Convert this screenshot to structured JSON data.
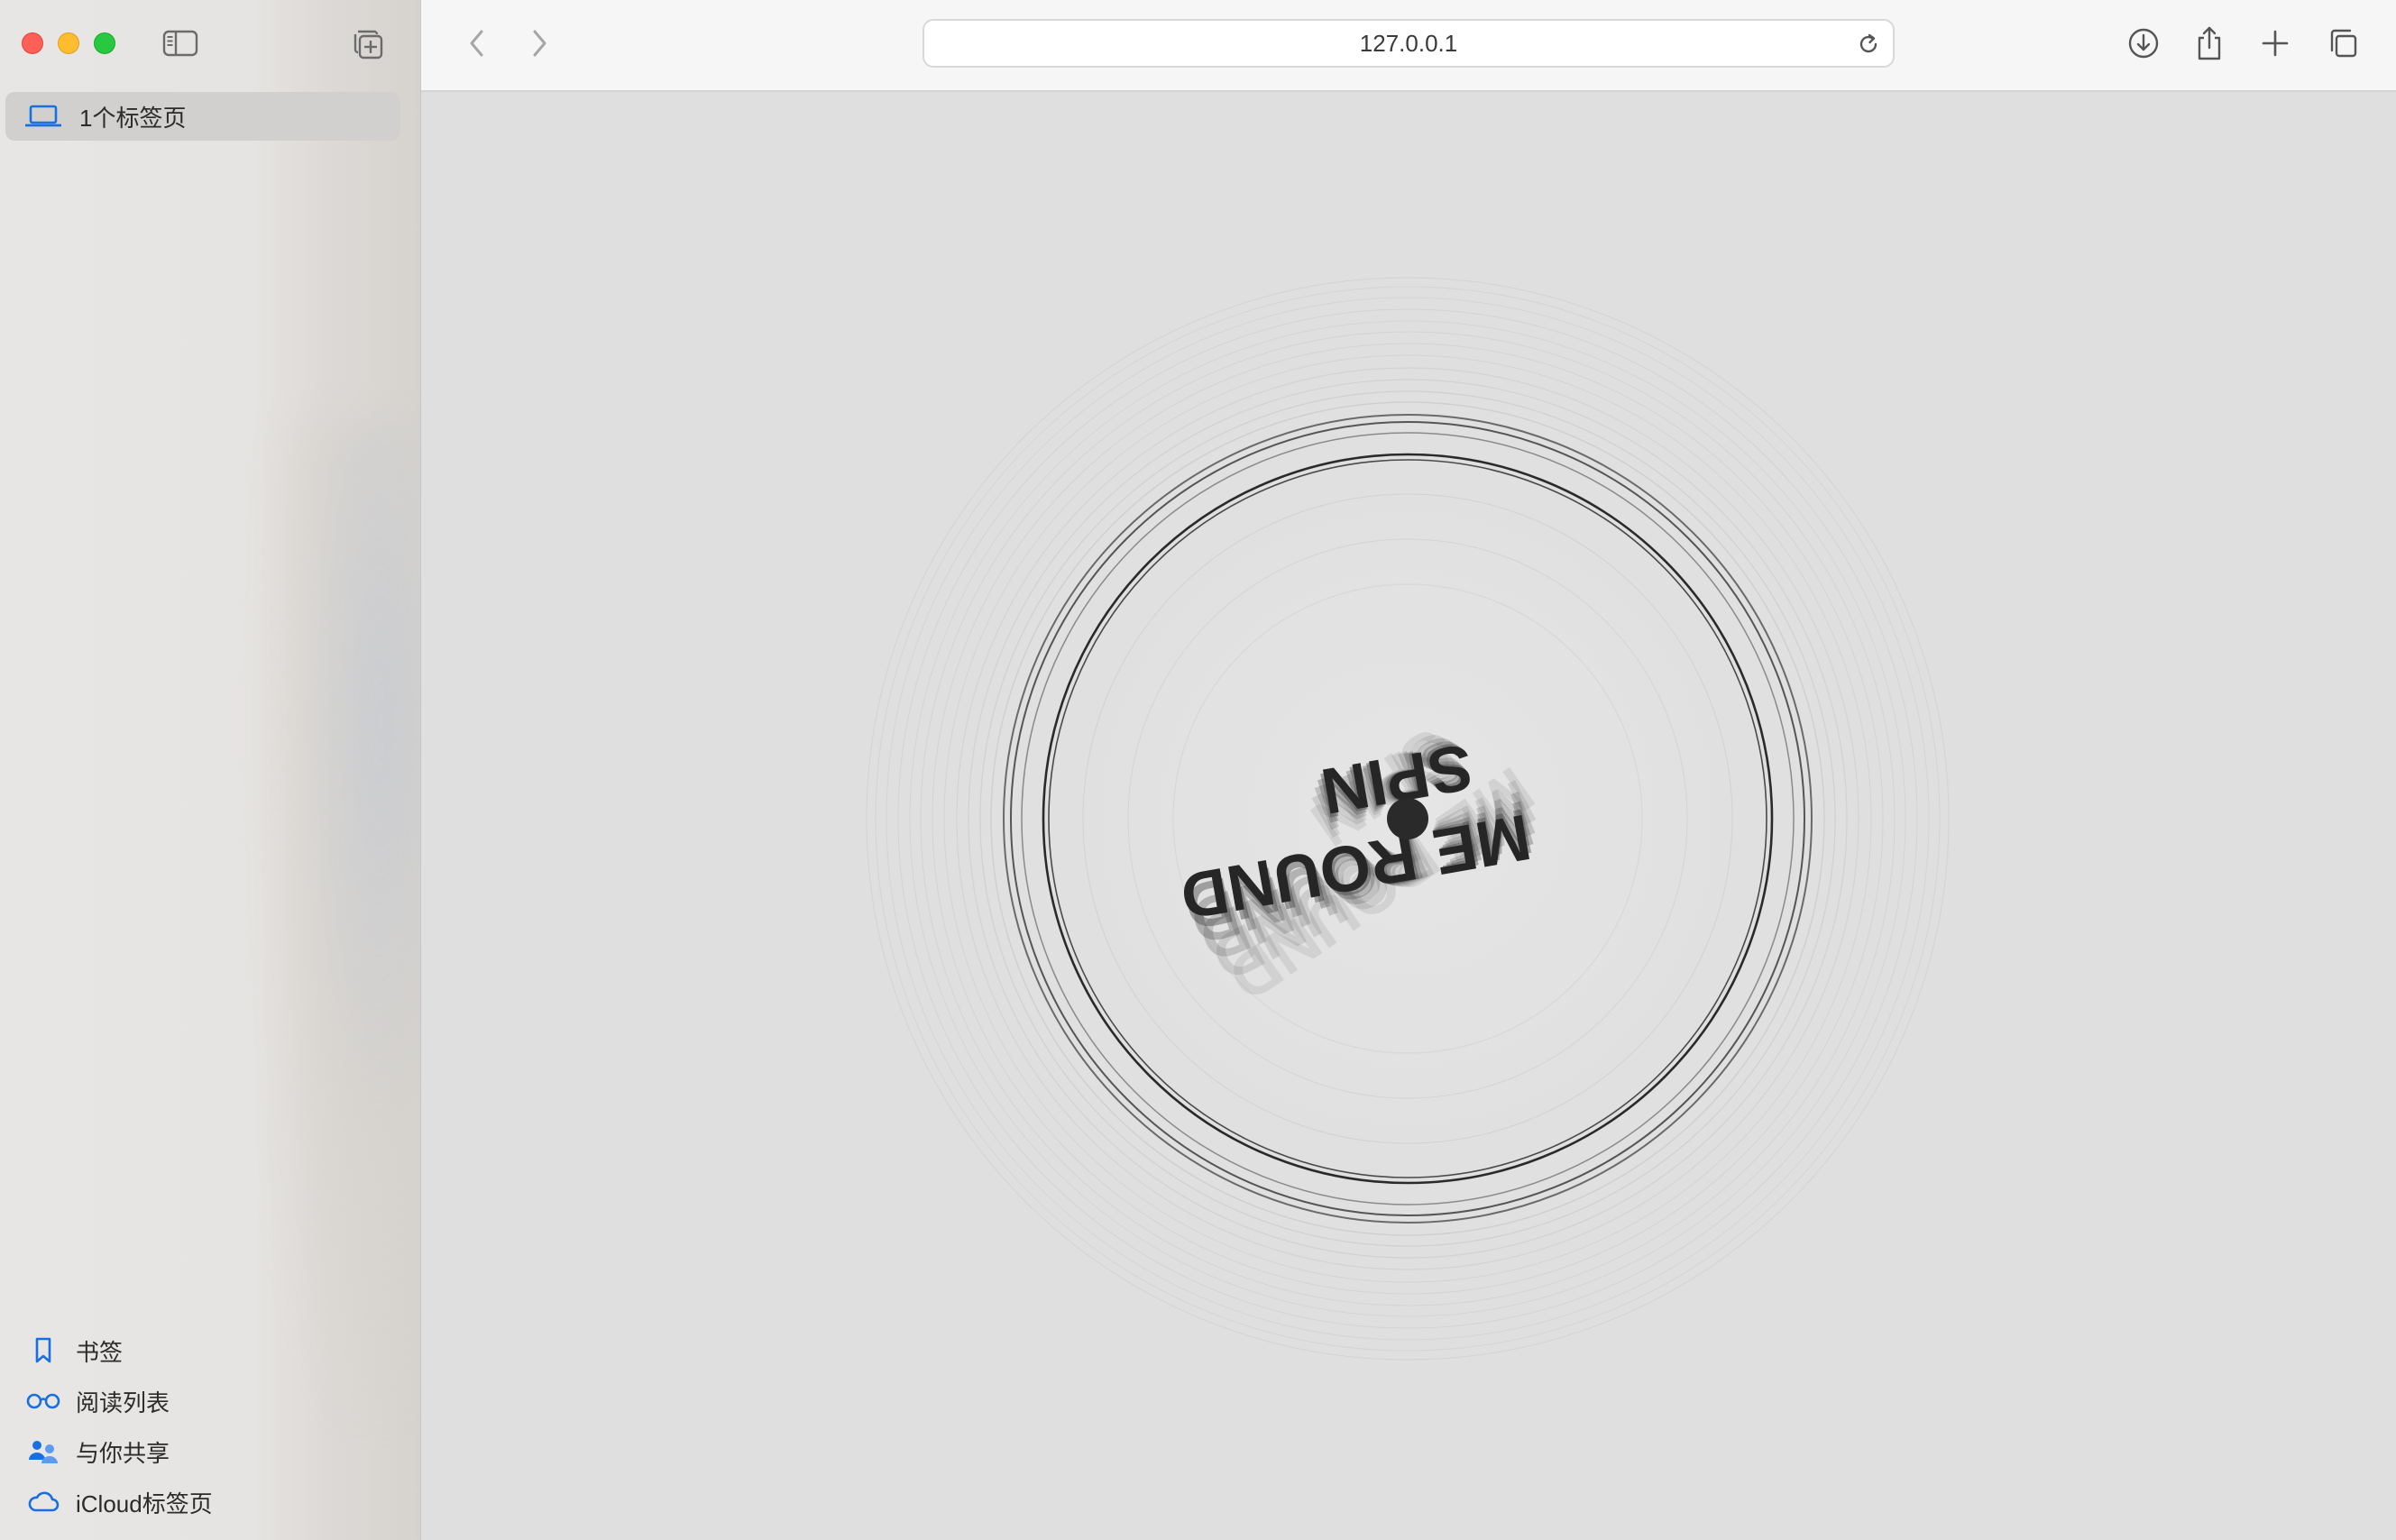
{
  "sidebar": {
    "tab_group": {
      "label": "1个标签页",
      "icon": "laptop-icon"
    },
    "bottom_items": [
      {
        "label": "书签",
        "icon": "bookmark-icon"
      },
      {
        "label": "阅读列表",
        "icon": "glasses-icon"
      },
      {
        "label": "与你共享",
        "icon": "shared-people-icon"
      },
      {
        "label": "iCloud标签页",
        "icon": "cloud-icon"
      }
    ]
  },
  "toolbar": {
    "address": {
      "url": "127.0.0.1"
    }
  },
  "canvas": {
    "text_line_1": "ME ROUND",
    "text_line_2": "SPIN"
  },
  "colors": {
    "accent": "#1a6fe0",
    "close": "#fe5f57",
    "minimize": "#febc2e",
    "maximize": "#28c840"
  }
}
